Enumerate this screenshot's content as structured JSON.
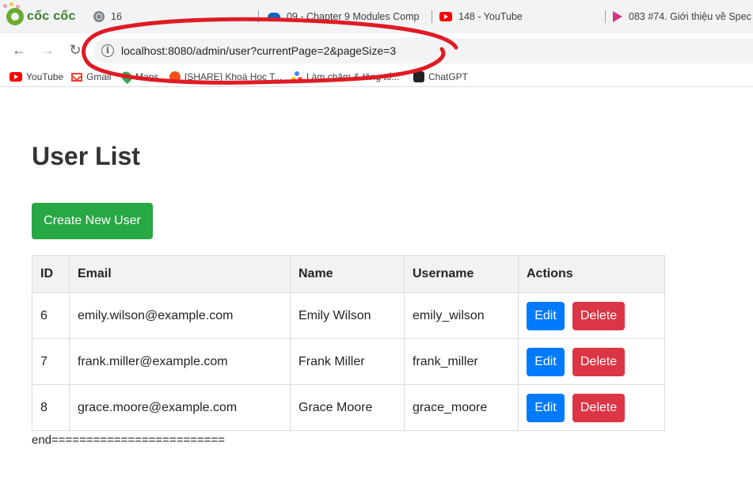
{
  "browser": {
    "brand": "cốc cốc",
    "tabs": [
      {
        "label": "16",
        "icon": "globe-icon"
      },
      {
        "label": "09 - Chapter 9 Modules Comp",
        "icon": "cloud-icon"
      },
      {
        "label": "148 - YouTube",
        "icon": "youtube-icon"
      },
      {
        "label": "083 #74. Giới thiệu về Spec",
        "icon": "play-icon"
      }
    ],
    "url": "localhost:8080/admin/user?currentPage=2&pageSize=3",
    "annotation_color": "#e01b24",
    "bookmarks": [
      {
        "label": "YouTube",
        "icon": "youtube-icon"
      },
      {
        "label": "Gmail",
        "icon": "gmail-icon"
      },
      {
        "label": "Maps",
        "icon": "maps-icon"
      },
      {
        "label": "[SHARE] Khoá Học T...",
        "icon": "share-icon"
      },
      {
        "label": "Làm chậm & tăng tố...",
        "icon": "app-icon"
      },
      {
        "label": "ChatGPT",
        "icon": "chatgpt-icon"
      }
    ]
  },
  "page": {
    "title": "User List",
    "create_label": "Create New User",
    "table": {
      "headers": [
        "ID",
        "Email",
        "Name",
        "Username",
        "Actions"
      ],
      "rows": [
        {
          "id": "6",
          "email": "emily.wilson@example.com",
          "name": "Emily Wilson",
          "username": "emily_wilson"
        },
        {
          "id": "7",
          "email": "frank.miller@example.com",
          "name": "Frank Miller",
          "username": "frank_miller"
        },
        {
          "id": "8",
          "email": "grace.moore@example.com",
          "name": "Grace Moore",
          "username": "grace_moore"
        }
      ],
      "edit_label": "Edit",
      "delete_label": "Delete"
    },
    "footer_text": "end========================="
  },
  "colors": {
    "create": "#28a745",
    "edit": "#007bff",
    "delete": "#dc3545"
  }
}
